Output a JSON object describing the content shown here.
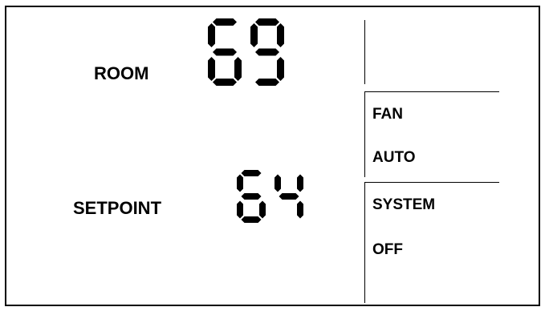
{
  "room": {
    "label": "ROOM",
    "value": "69"
  },
  "setpoint": {
    "label": "SETPOINT",
    "value": "64"
  },
  "fan": {
    "label": "FAN",
    "mode": "AUTO"
  },
  "system": {
    "label": "SYSTEM",
    "mode": "OFF"
  }
}
